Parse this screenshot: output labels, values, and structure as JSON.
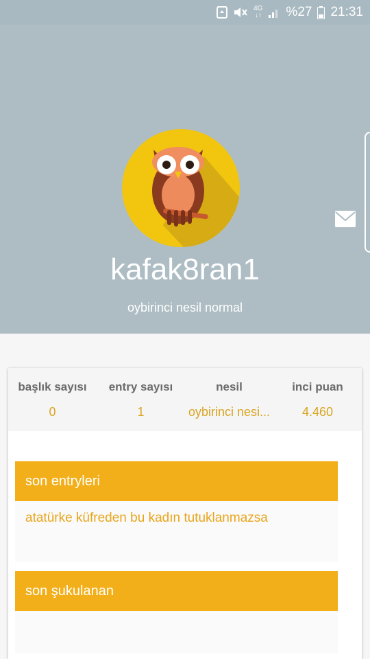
{
  "status_bar": {
    "battery_percent": "%27",
    "time": "21:31",
    "network": "4G"
  },
  "profile": {
    "username": "kafak8ran1",
    "generation_label": "oybirinci nesil normal"
  },
  "stats": [
    {
      "label": "başlık sayısı",
      "value": "0"
    },
    {
      "label": "entry sayısı",
      "value": "1"
    },
    {
      "label": "nesil",
      "value": "oybirinci nesi..."
    },
    {
      "label": "inci puan",
      "value": "4.460"
    }
  ],
  "sections": {
    "recent_entries": {
      "title": "son entryleri",
      "items": [
        "atatürke küfreden bu kadın tutuklanmazsa"
      ]
    },
    "recent_liked": {
      "title": "son şukulanan",
      "items": []
    }
  },
  "colors": {
    "header_bg": "#aebdc4",
    "accent": "#f2af19",
    "accent_text": "#e8a51b",
    "avatar_bg": "#f2c50f"
  }
}
